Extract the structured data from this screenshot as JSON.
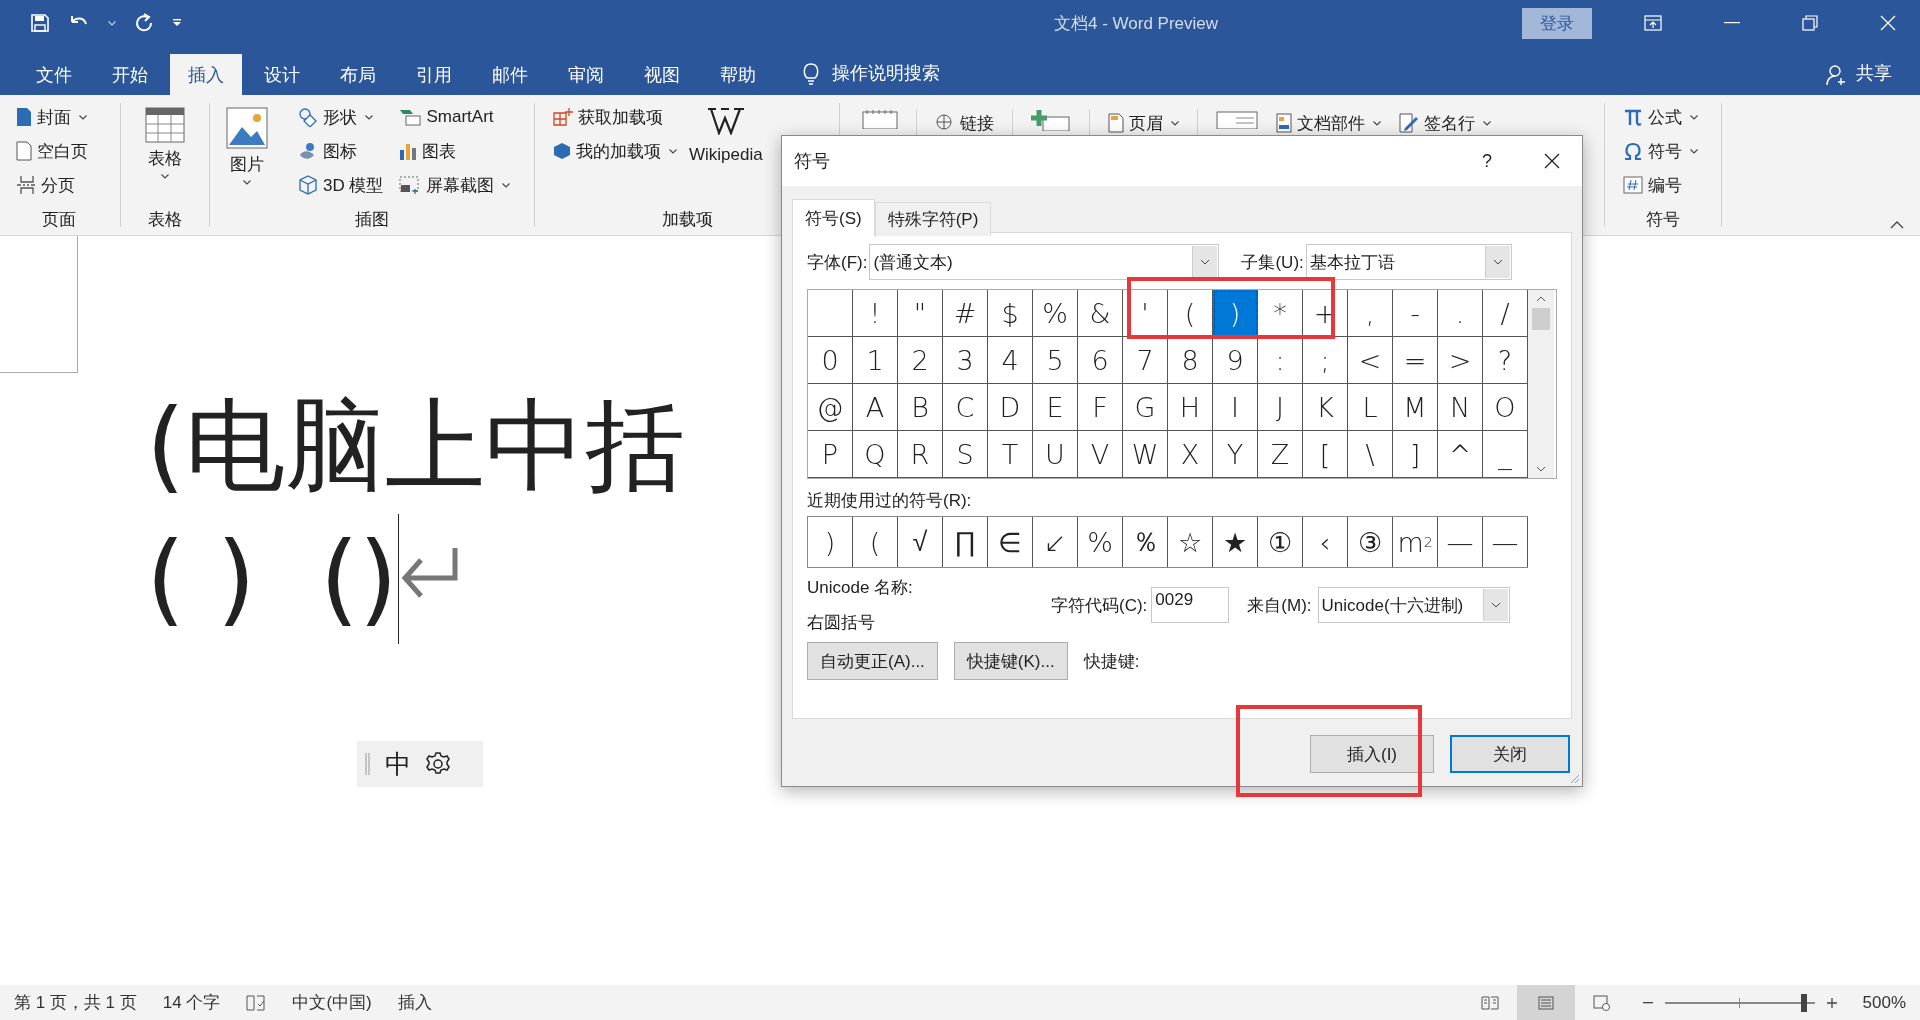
{
  "window": {
    "title": "文档4  -  Word Preview",
    "sign_in": "登录"
  },
  "tabs": [
    {
      "label": "文件",
      "selected": false
    },
    {
      "label": "开始",
      "selected": false
    },
    {
      "label": "插入",
      "selected": true
    },
    {
      "label": "设计",
      "selected": false
    },
    {
      "label": "布局",
      "selected": false
    },
    {
      "label": "引用",
      "selected": false
    },
    {
      "label": "邮件",
      "selected": false
    },
    {
      "label": "审阅",
      "selected": false
    },
    {
      "label": "视图",
      "selected": false
    },
    {
      "label": "帮助",
      "selected": false
    }
  ],
  "tell_me": "操作说明搜索",
  "share": "共享",
  "ribbon": {
    "pages": {
      "label": "页面",
      "cover": "封面",
      "blank_page": "空白页",
      "page_break": "分页"
    },
    "tables": {
      "label": "表格",
      "table": "表格"
    },
    "illustrations": {
      "label": "插图",
      "pictures": "图片",
      "shapes": "形状",
      "icons": "图标",
      "models": "3D 模型",
      "smartart": "SmartArt",
      "chart": "图表",
      "screenshot": "屏幕截图"
    },
    "addins": {
      "label": "加载项",
      "get": "获取加载项",
      "mine": "我的加载项",
      "wikipedia": "Wikipedia"
    },
    "links": {
      "link": "链接",
      "header": "页眉",
      "quick_parts": "文档部件",
      "signature": "签名行"
    },
    "symbols": {
      "label": "符号",
      "equation": "公式",
      "symbol": "符号",
      "number": "编号"
    }
  },
  "document": {
    "heading": "(电脑上中括",
    "line_2a": "( )",
    "line_2b": "()",
    "ime": "中"
  },
  "dialog": {
    "title": "符号",
    "help": "?",
    "tabs": [
      {
        "label": "符号(S)",
        "selected": true
      },
      {
        "label": "特殊字符(P)",
        "selected": false
      }
    ],
    "font_label": "字体(F):",
    "font_value": "(普通文本)",
    "subset_label": "子集(U):",
    "subset_value": "基本拉丁语",
    "grid": [
      {
        "kind": "blank",
        "selected": false
      },
      {
        "kind": "glyph",
        "char": "!",
        "selected": false
      },
      {
        "kind": "glyph",
        "char": "\"",
        "selected": false
      },
      {
        "kind": "glyph",
        "char": "#",
        "selected": false
      },
      {
        "kind": "glyph",
        "char": "$",
        "selected": false
      },
      {
        "kind": "glyph",
        "char": "%",
        "selected": false
      },
      {
        "kind": "glyph",
        "char": "&",
        "selected": false
      },
      {
        "kind": "glyph",
        "char": "'",
        "selected": false
      },
      {
        "kind": "glyph",
        "char": "(",
        "selected": false
      },
      {
        "kind": "glyph",
        "char": ")",
        "selected": true
      },
      {
        "kind": "glyph",
        "char": "*",
        "selected": false
      },
      {
        "kind": "glyph",
        "char": "+",
        "selected": false
      },
      {
        "kind": "glyph",
        "char": ",",
        "selected": false
      },
      {
        "kind": "glyph",
        "char": "-",
        "selected": false
      },
      {
        "kind": "glyph",
        "char": ".",
        "selected": false
      },
      {
        "kind": "glyph",
        "char": "/",
        "selected": false
      },
      {
        "kind": "glyph",
        "char": "0",
        "selected": false
      },
      {
        "kind": "glyph",
        "char": "1",
        "selected": false
      },
      {
        "kind": "glyph",
        "char": "2",
        "selected": false
      },
      {
        "kind": "glyph",
        "char": "3",
        "selected": false
      },
      {
        "kind": "glyph",
        "char": "4",
        "selected": false
      },
      {
        "kind": "glyph",
        "char": "5",
        "selected": false
      },
      {
        "kind": "glyph",
        "char": "6",
        "selected": false
      },
      {
        "kind": "glyph",
        "char": "7",
        "selected": false
      },
      {
        "kind": "glyph",
        "char": "8",
        "selected": false
      },
      {
        "kind": "glyph",
        "char": "9",
        "selected": false
      },
      {
        "kind": "glyph",
        "char": ":",
        "selected": false
      },
      {
        "kind": "glyph",
        "char": ";",
        "selected": false
      },
      {
        "kind": "glyph",
        "char": "<",
        "selected": false
      },
      {
        "kind": "glyph",
        "char": "=",
        "selected": false
      },
      {
        "kind": "glyph",
        "char": ">",
        "selected": false
      },
      {
        "kind": "glyph",
        "char": "?",
        "selected": false
      },
      {
        "kind": "glyph",
        "char": "@",
        "selected": false
      },
      {
        "kind": "glyph",
        "char": "A",
        "selected": false
      },
      {
        "kind": "glyph",
        "char": "B",
        "selected": false
      },
      {
        "kind": "glyph",
        "char": "C",
        "selected": false
      },
      {
        "kind": "glyph",
        "char": "D",
        "selected": false
      },
      {
        "kind": "glyph",
        "char": "E",
        "selected": false
      },
      {
        "kind": "glyph",
        "char": "F",
        "selected": false
      },
      {
        "kind": "glyph",
        "char": "G",
        "selected": false
      },
      {
        "kind": "glyph",
        "char": "H",
        "selected": false
      },
      {
        "kind": "glyph",
        "char": "I",
        "selected": false
      },
      {
        "kind": "glyph",
        "char": "J",
        "selected": false
      },
      {
        "kind": "glyph",
        "char": "K",
        "selected": false
      },
      {
        "kind": "glyph",
        "char": "L",
        "selected": false
      },
      {
        "kind": "glyph",
        "char": "M",
        "selected": false
      },
      {
        "kind": "glyph",
        "char": "N",
        "selected": false
      },
      {
        "kind": "glyph",
        "char": "O",
        "selected": false
      },
      {
        "kind": "glyph",
        "char": "P",
        "selected": false
      },
      {
        "kind": "glyph",
        "char": "Q",
        "selected": false
      },
      {
        "kind": "glyph",
        "char": "R",
        "selected": false
      },
      {
        "kind": "glyph",
        "char": "S",
        "selected": false
      },
      {
        "kind": "glyph",
        "char": "T",
        "selected": false
      },
      {
        "kind": "glyph",
        "char": "U",
        "selected": false
      },
      {
        "kind": "glyph",
        "char": "V",
        "selected": false
      },
      {
        "kind": "glyph",
        "char": "W",
        "selected": false
      },
      {
        "kind": "glyph",
        "char": "X",
        "selected": false
      },
      {
        "kind": "glyph",
        "char": "Y",
        "selected": false
      },
      {
        "kind": "glyph",
        "char": "Z",
        "selected": false
      },
      {
        "kind": "glyph",
        "char": "[",
        "selected": false
      },
      {
        "kind": "glyph",
        "char": "\\",
        "selected": false
      },
      {
        "kind": "glyph",
        "char": "]",
        "selected": false
      },
      {
        "kind": "glyph",
        "char": "^",
        "selected": false
      },
      {
        "kind": "glyph",
        "char": "_",
        "selected": false
      }
    ],
    "recent_label": "近期使用过的符号(R):",
    "recent": [
      ")",
      "(",
      "√",
      "∏",
      "∈",
      "↙",
      "%",
      "％",
      "☆",
      "★",
      "①",
      "‹",
      "③",
      "m$^{2}$",
      "—",
      "—"
    ],
    "unicode_name_label": "Unicode 名称:",
    "unicode_name": "右圆括号",
    "code_label": "字符代码(C):",
    "code_value": "0029",
    "from_label": "来自(M):",
    "from_value": "Unicode(十六进制)",
    "autocorrect": "自动更正(A)...",
    "shortcut_key": "快捷键(K)...",
    "shortcut_label": "快捷键:",
    "insert": "插入(I)",
    "close": "关闭"
  },
  "status_bar": {
    "page": "第 1 页，共 1 页",
    "words": "14 个字",
    "language": "中文(中国)",
    "mode": "插入",
    "views": [
      {
        "kind": "read",
        "selected": false
      },
      {
        "kind": "print",
        "selected": true
      },
      {
        "kind": "web",
        "selected": false
      }
    ],
    "zoom": {
      "level": 0.93,
      "reading": "500%"
    }
  }
}
